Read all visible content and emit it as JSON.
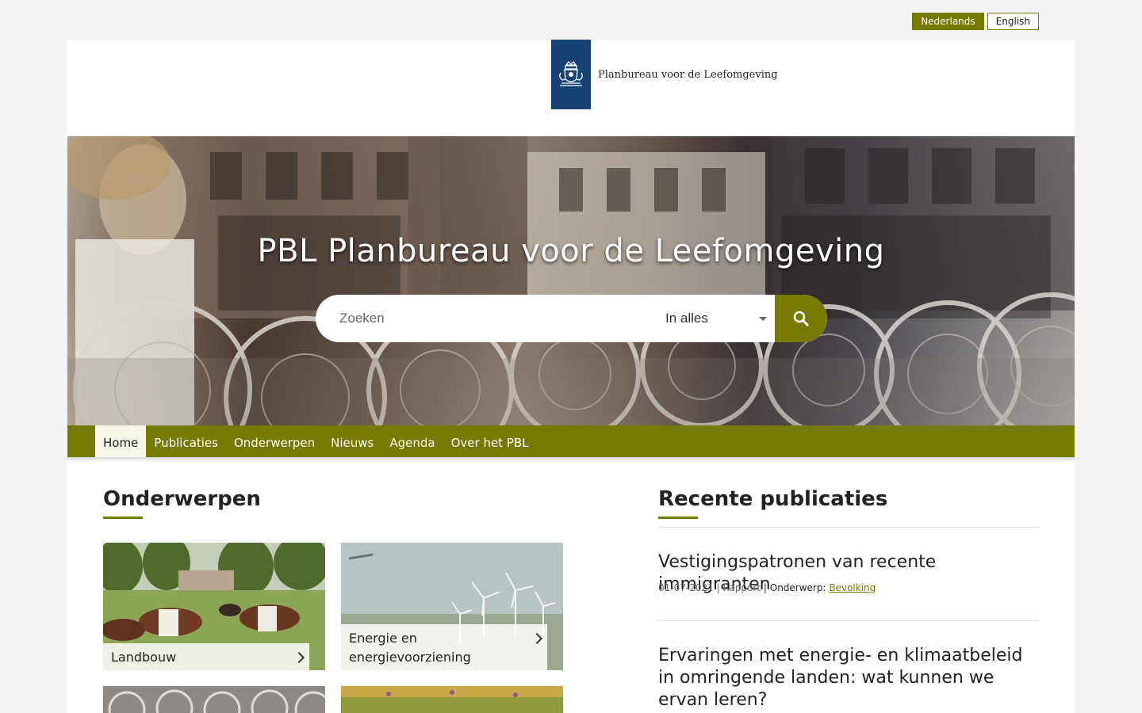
{
  "language": {
    "nl": "Nederlands",
    "en": "English"
  },
  "header": {
    "org_name": "Planbureau voor de Leefomgeving"
  },
  "hero": {
    "title": "PBL Planbureau voor de Leefomgeving"
  },
  "search": {
    "placeholder": "Zoeken",
    "scope": "In alles"
  },
  "nav": {
    "items": [
      "Home",
      "Publicaties",
      "Onderwerpen",
      "Nieuws",
      "Agenda",
      "Over het PBL"
    ]
  },
  "topics": {
    "title": "Onderwerpen",
    "items": [
      {
        "label": "Landbouw"
      },
      {
        "label": "Energie en energievoorziening"
      }
    ]
  },
  "publications": {
    "title": "Recente publicaties",
    "items": [
      {
        "title": "Vestigingspatronen van recente immigranten",
        "date_type": "01-07-2021 | Rapport",
        "subject_label": "| Onderwerp:",
        "subject": "Bevolking"
      },
      {
        "title": "Ervaringen met energie- en klimaatbeleid in omringende landen: wat kunnen we ervan leren?"
      }
    ]
  },
  "colors": {
    "accent": "#757a00",
    "rijksoverheid_blue": "#154273"
  }
}
